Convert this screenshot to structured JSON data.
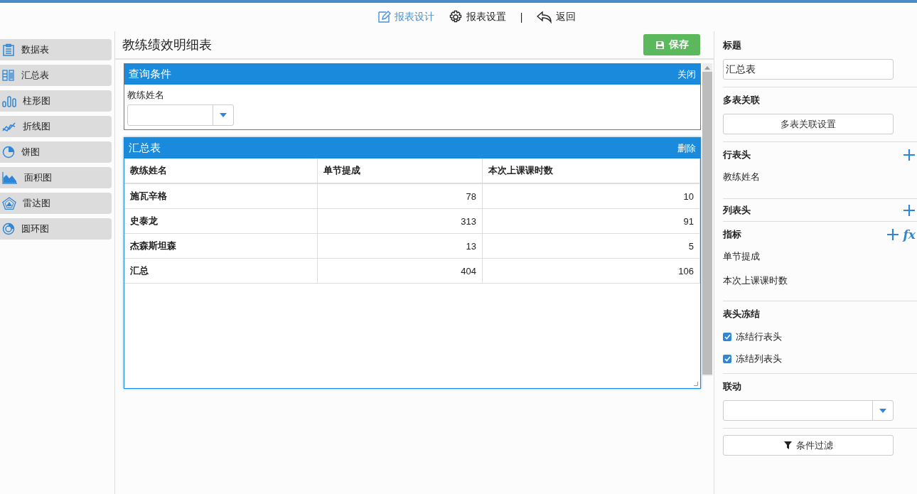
{
  "toolbar": {
    "items": [
      {
        "kind": "design",
        "label": "报表设计",
        "selected": true
      },
      {
        "kind": "settings",
        "label": "报表设置",
        "selected": false
      }
    ],
    "separator": "|",
    "back": "返回"
  },
  "sidebar": {
    "items": [
      {
        "kind": "table",
        "label": "数据表"
      },
      {
        "kind": "pivot",
        "label": "汇总表"
      },
      {
        "kind": "bar",
        "label": "柱形图"
      },
      {
        "kind": "line",
        "label": "折线图"
      },
      {
        "kind": "pie",
        "label": "饼图"
      },
      {
        "kind": "area",
        "label": "面积图"
      },
      {
        "kind": "radar",
        "label": "雷达图"
      },
      {
        "kind": "donut",
        "label": "圆环图"
      }
    ]
  },
  "report": {
    "title": "教练绩效明细表",
    "save": "保存",
    "query_panel": {
      "title": "查询条件",
      "close": "关闭",
      "field_label": "教练姓名"
    },
    "summary_panel": {
      "title": "汇总表",
      "delete": "删除",
      "columns": [
        "教练姓名",
        "单节提成",
        "本次上课课时数"
      ],
      "rows": [
        [
          "施瓦辛格",
          "78",
          "10"
        ],
        [
          "史泰龙",
          "313",
          "91"
        ],
        [
          "杰森斯坦森",
          "13",
          "5"
        ],
        [
          "汇总",
          "404",
          "106"
        ]
      ]
    }
  },
  "properties": {
    "title_label": "标题",
    "title_value": "汇总表",
    "join_label": "多表关联",
    "join_button": "多表关联设置",
    "row_header": {
      "label": "行表头",
      "items": [
        "教练姓名"
      ]
    },
    "column_header": {
      "label": "列表头"
    },
    "metrics": {
      "label": "指标",
      "formula": "fx",
      "items": [
        "单节提成",
        "本次上课课时数"
      ]
    },
    "freeze": {
      "label": "表头冻结",
      "options": [
        {
          "label": "冻结行表头",
          "checked": true
        },
        {
          "label": "冻结列表头",
          "checked": true
        }
      ]
    },
    "linkage_label": "联动",
    "filter_button": "条件过滤"
  }
}
